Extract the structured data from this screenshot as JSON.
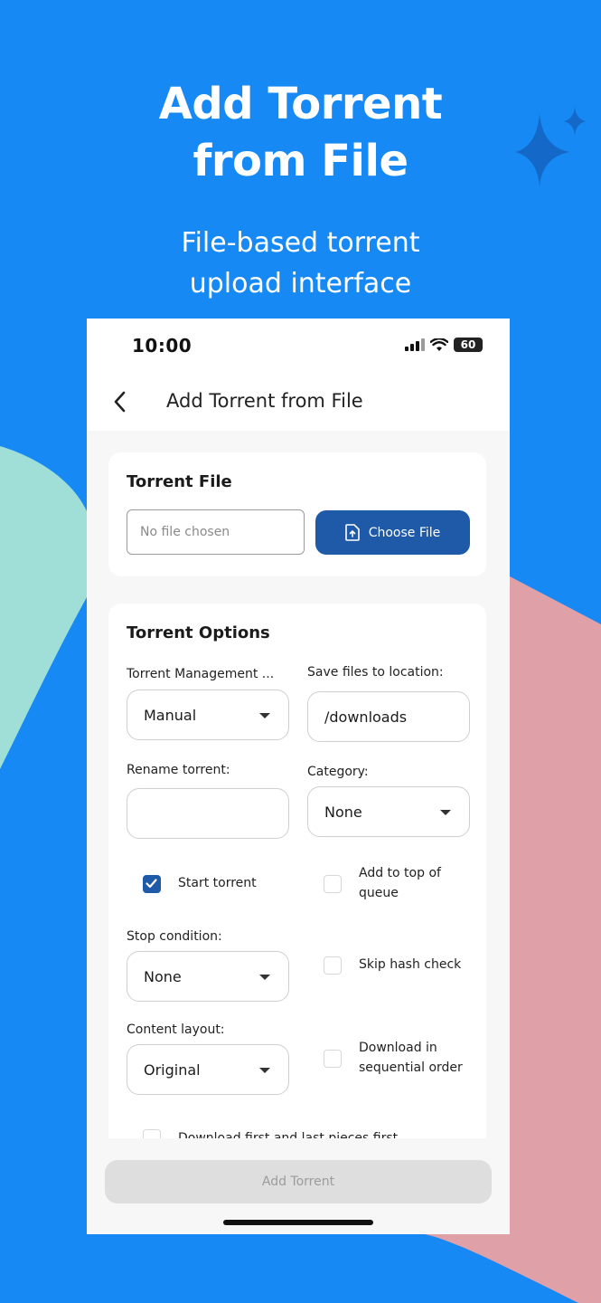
{
  "marketing": {
    "title_line1": "Add Torrent",
    "title_line2": "from File",
    "subtitle_line1": "File-based torrent",
    "subtitle_line2": "upload interface"
  },
  "status_bar": {
    "time": "10:00",
    "battery": "60"
  },
  "app_bar": {
    "title": "Add Torrent from File"
  },
  "torrent_file": {
    "title": "Torrent File",
    "placeholder": "No file chosen",
    "choose_label": "Choose File"
  },
  "options": {
    "title": "Torrent Options",
    "management_label": "Torrent Management ...",
    "management_value": "Manual",
    "save_label": "Save files to location:",
    "save_value": "/downloads",
    "rename_label": "Rename torrent:",
    "rename_value": "",
    "category_label": "Category:",
    "category_value": "None",
    "start_torrent": {
      "label": "Start torrent",
      "checked": true
    },
    "add_to_top": {
      "label_line1": "Add to top of",
      "label_line2": "queue",
      "checked": false
    },
    "stop_label": "Stop condition:",
    "stop_value": "None",
    "skip_hash": {
      "label": "Skip hash check",
      "checked": false
    },
    "layout_label": "Content layout:",
    "layout_value": "Original",
    "sequential": {
      "label_line1": "Download in",
      "label_line2": "sequential order",
      "checked": false
    },
    "first_last": {
      "label": "Download first and last pieces first",
      "checked": false
    }
  },
  "footer": {
    "add_label": "Add Torrent"
  },
  "colors": {
    "background": "#1689f5",
    "primary_button": "#1e5aa8",
    "mint_shape": "#9fdfd8",
    "pink_shape": "#e0a0a7"
  }
}
